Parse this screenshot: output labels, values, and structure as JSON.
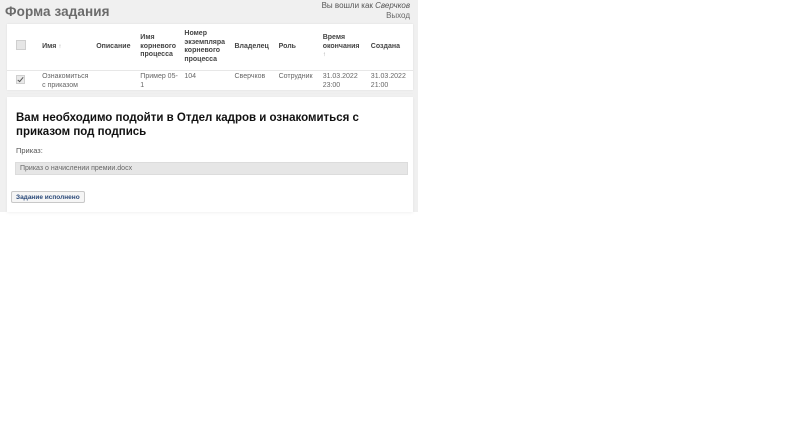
{
  "header": {
    "title": "Форма задания",
    "logged_in_prefix": "Вы вошли как ",
    "username": "Сверчков",
    "logout_label": "Выход"
  },
  "tasks_table": {
    "columns": {
      "name": "Имя",
      "name_sort": "↑",
      "description": "Описание",
      "root_process_name": "Имя корневого процесса",
      "root_instance_number": "Номер экземпляра корневого процесса",
      "owner": "Владелец",
      "role": "Роль",
      "deadline": "Время окончания",
      "deadline_sort": "↑",
      "created": "Создана"
    },
    "rows": [
      {
        "checked": true,
        "name": "Ознакомиться с приказом",
        "description": "",
        "root_process_name": "Пример 05-1",
        "root_instance_number": "104",
        "owner": "Сверчков",
        "role": "Сотрудник",
        "deadline": "31.03.2022 23:00",
        "created": "31.03.2022 21:00"
      }
    ]
  },
  "task_form": {
    "heading": "Вам необходимо подойти в Отдел кадров и ознакомиться с приказом под подпись",
    "field_label": "Приказ:",
    "field_value": "Приказ о начислении премии.docx",
    "done_button": "Задание исполнено"
  }
}
